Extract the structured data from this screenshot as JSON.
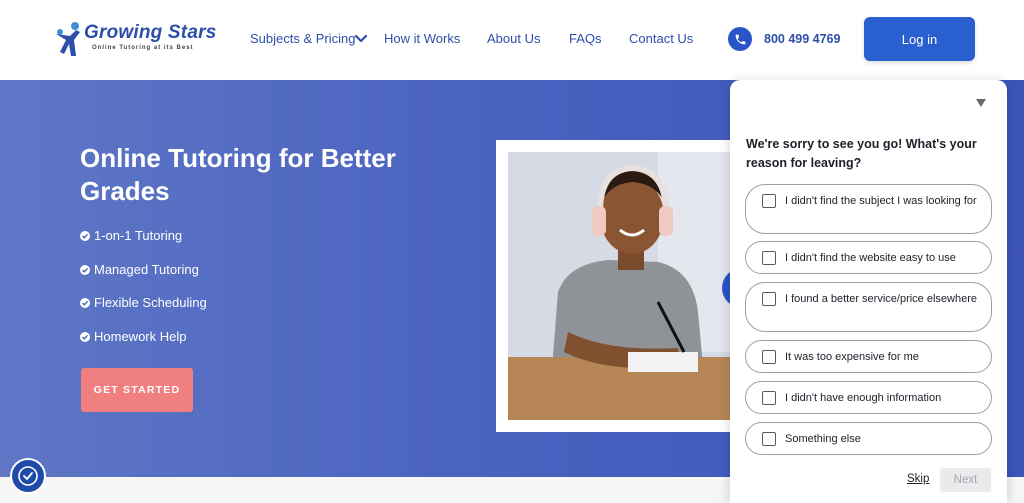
{
  "brand": {
    "name": "Growing Stars",
    "tagline": "Online Tutoring at its Best",
    "color": "#2d4fa8"
  },
  "nav": {
    "subjects": "Subjects & Pricing",
    "how": "How it Works",
    "about": "About Us",
    "faqs": "FAQs",
    "contact": "Contact Us",
    "phone": "800 499 4769",
    "login": "Log in"
  },
  "hero": {
    "title": "Online Tutoring for Better Grades",
    "features": [
      "1-on-1 Tutoring",
      "Managed Tutoring",
      "Flexible Scheduling",
      "Homework Help"
    ],
    "cta": "GET STARTED"
  },
  "survey": {
    "question": "We're sorry to see you go! What's your reason for leaving?",
    "options": [
      "I didn't find the subject I was looking for",
      "I didn't find the website easy to use",
      "I found a better service/price elsewhere",
      "It was too expensive for me",
      "I didn't have enough information",
      "Something else"
    ],
    "skip": "Skip",
    "next": "Next"
  },
  "icons": {
    "phone": "phone-icon",
    "collapse": "triangle-down-icon",
    "accessibility": "accessibility-icon",
    "chevron": "chevron-down-icon"
  },
  "colors": {
    "accent": "#2a5fcf",
    "cta": "#f08080",
    "hero": "#4a63c0"
  }
}
